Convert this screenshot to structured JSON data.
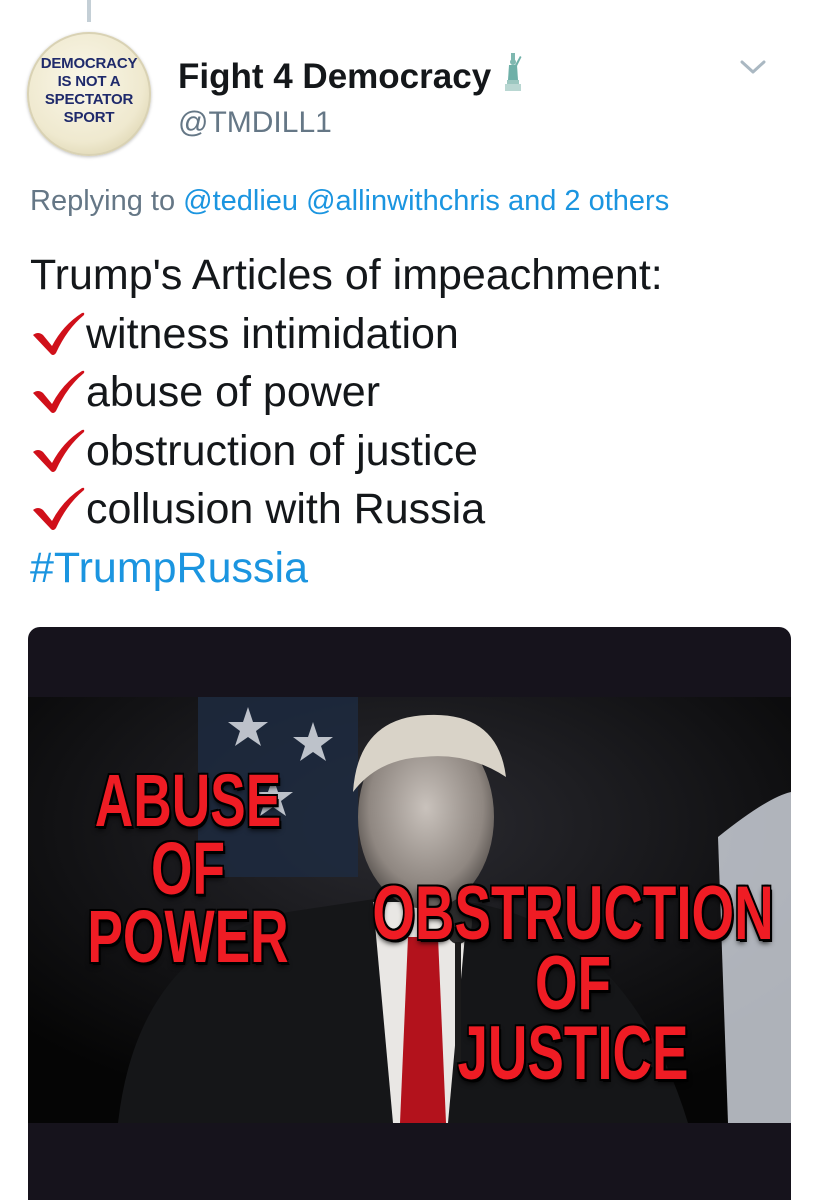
{
  "author": {
    "avatar_text": [
      "DEMOCRACY",
      "IS NOT A",
      "SPECTATOR",
      "SPORT"
    ],
    "display_name": "Fight 4 Democracy",
    "name_emoji": "statue-of-liberty-icon",
    "handle": "@TMDILL1"
  },
  "reply": {
    "prefix": "Replying to",
    "mentions": "@tedlieu @allinwithchris and 2 others"
  },
  "tweet": {
    "title": "Trump's Articles of impeachment:",
    "items": [
      "witness intimidation",
      "abuse of power",
      "obstruction of justice",
      "collusion with Russia"
    ],
    "check_icon": "red-check-mark-icon",
    "hashtag": "#TrumpRussia"
  },
  "media": {
    "caption_left": [
      "ABUSE",
      "OF",
      "POWER"
    ],
    "caption_right": [
      "OBSTRUCTION",
      "OF",
      "JUSTICE"
    ]
  },
  "icons": {
    "menu": "chevron-down-icon"
  },
  "colors": {
    "link": "#1b95e0",
    "text": "#14171a",
    "secondary": "#657786",
    "check": "#d0101a",
    "caption": "#ef1c24"
  }
}
